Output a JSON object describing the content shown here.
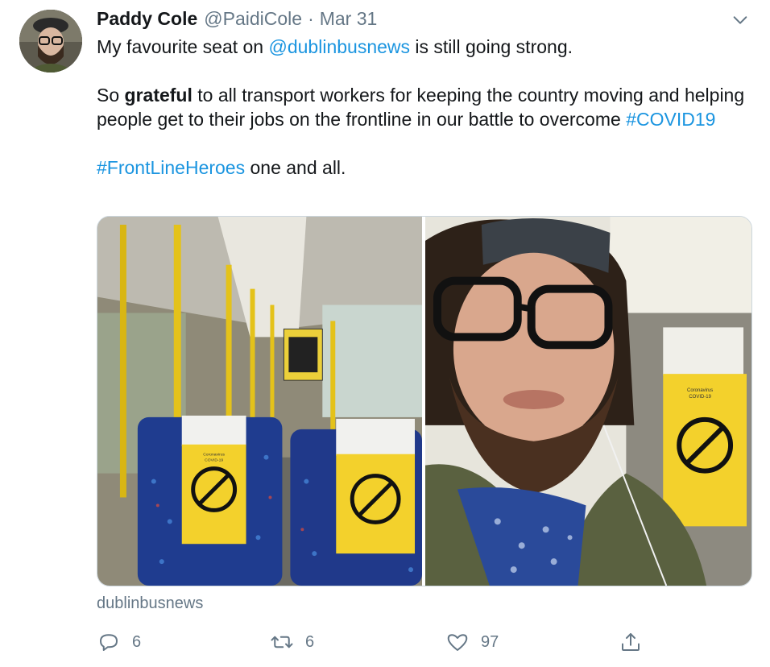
{
  "tweet": {
    "author_name": "Paddy Cole",
    "author_handle": "@PaidiCole",
    "separator": "·",
    "date": "Mar 31",
    "line1_pre": "My favourite seat on ",
    "line1_mention": "@dublinbusnews",
    "line1_post": " is still going strong.",
    "line2_pre": "So ",
    "line2_bold": "grateful",
    "line2_post": " to all transport workers for keeping the country moving and helping people get to their jobs on the frontline in our battle to overcome ",
    "line2_hashtag": "#COVID19",
    "line3_hashtag": "#FrontLineHeroes",
    "line3_post": " one and all.",
    "source_account": "dublinbusnews"
  },
  "photos": {
    "left_sign_line1": "Coronavirus",
    "left_sign_line2": "COVID-19",
    "right_sign_line1": "Coronavirus",
    "right_sign_line2": "COVID-19"
  },
  "actions": {
    "reply_count": "6",
    "retweet_count": "6",
    "like_count": "97"
  },
  "colors": {
    "link": "#1b95e0",
    "muted": "#657786",
    "text": "#14171a",
    "sign_yellow": "#f3d12c"
  },
  "icons": {
    "caret": "chevron-down-icon",
    "reply": "reply-icon",
    "retweet": "retweet-icon",
    "like": "heart-icon",
    "share": "share-icon"
  }
}
